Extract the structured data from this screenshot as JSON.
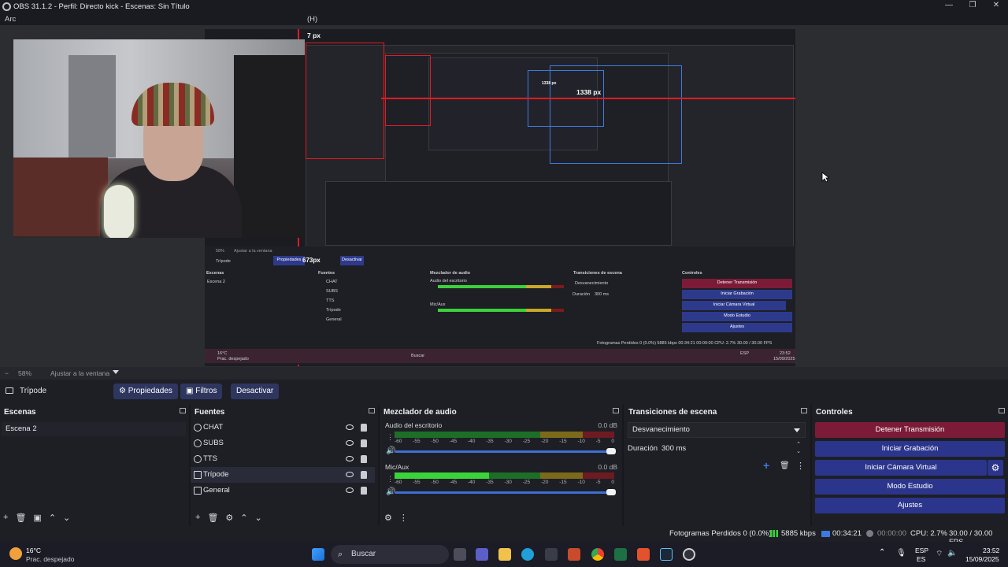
{
  "window": {
    "title": "OBS 31.1.2 - Perfil: Directo kick - Escenas: Sin Título",
    "controls": [
      "—",
      "❐",
      "✕"
    ]
  },
  "menubar": {
    "left": "Arc",
    "right": "(H)"
  },
  "preview": {
    "labels": {
      "px_top": "7 px",
      "px_right": "1338 px",
      "px_small": "1338 px",
      "px_mid": "673px"
    },
    "mini": {
      "scene_source": "Trípode",
      "props": "Propiedades",
      "deactivate": "Desactivar",
      "zoom": "58%",
      "fit": "Ajustar a la ventana",
      "docks": [
        "Escenas",
        "Fuentes",
        "Mezclador de audio",
        "Transiciones de escena",
        "Controles"
      ],
      "scene": "Escena 2",
      "sources": [
        "CHAT",
        "SUBS",
        "TTS",
        "Trípode",
        "General"
      ],
      "audio": [
        "Audio del escritorio",
        "Mic/Aux"
      ],
      "transition": "Desvanecimiento",
      "duration_label": "Duración",
      "duration": "300 ms",
      "controls": [
        "Detener Transmisión",
        "Iniciar Grabación",
        "Iniciar Cámara Virtual",
        "Modo Estudio",
        "Ajustes"
      ],
      "status": "Fotogramas Perdidos 0 (0.0%)   5885 kbps   00:34:21   00:00:00   CPU: 2.7%   30.00 / 30.00 FPS",
      "taskbar_search": "Buscar",
      "weather": "16°C",
      "weather_desc": "Prac. despejado",
      "time": "23:52",
      "date": "15/09/2025",
      "lang": "ESP"
    }
  },
  "zoombar": {
    "minus": "−",
    "zoom": "58%",
    "fit": "Ajustar a la ventana"
  },
  "source_toolbar": {
    "source_name": "Trípode",
    "properties": "Propiedades",
    "filters": "Filtros",
    "deactivate": "Desactivar"
  },
  "scenes": {
    "title": "Escenas",
    "items": [
      "Escena 2"
    ]
  },
  "sources": {
    "title": "Fuentes",
    "items": [
      {
        "name": "CHAT",
        "icon": "browser-icon"
      },
      {
        "name": "SUBS",
        "icon": "browser-icon"
      },
      {
        "name": "TTS",
        "icon": "browser-icon"
      },
      {
        "name": "Trípode",
        "icon": "camera-icon"
      },
      {
        "name": "General",
        "icon": "monitor-icon"
      }
    ]
  },
  "mixer": {
    "title": "Mezclador de audio",
    "channels": [
      {
        "name": "Audio del escritorio",
        "db": "0.0 dB",
        "level": 0
      },
      {
        "name": "Mic/Aux",
        "db": "0.0 dB",
        "level": 0.43
      }
    ],
    "ticks": [
      "-60",
      "-55",
      "-50",
      "-45",
      "-40",
      "-35",
      "-30",
      "-25",
      "-20",
      "-15",
      "-10",
      "-5",
      "0"
    ]
  },
  "transitions": {
    "title": "Transiciones de escena",
    "selected": "Desvanecimiento",
    "duration_label": "Duración",
    "duration": "300 ms"
  },
  "controls": {
    "title": "Controles",
    "stop_stream": "Detener Transmisión",
    "start_recording": "Iniciar Grabación",
    "virtual_cam": "Iniciar Cámara Virtual",
    "studio_mode": "Modo Estudio",
    "settings": "Ajustes"
  },
  "status": {
    "dropped": "Fotogramas Perdidos 0 (0.0%)",
    "bitrate": "5885 kbps",
    "stream_time": "00:34:21",
    "rec_time": "00:00:00",
    "cpu": "CPU: 2.7%",
    "fps": "30.00 / 30.00 FPS"
  },
  "taskbar": {
    "temp": "16°C",
    "weather": "Prac. despejado",
    "search": "Buscar",
    "lang1": "ESP",
    "lang2": "ES",
    "time": "23:52",
    "date": "15/09/2025"
  },
  "colors": {
    "accent_blue": "#2b358c",
    "stop_red": "#7b1b38",
    "meter_green": "#39d33a"
  }
}
